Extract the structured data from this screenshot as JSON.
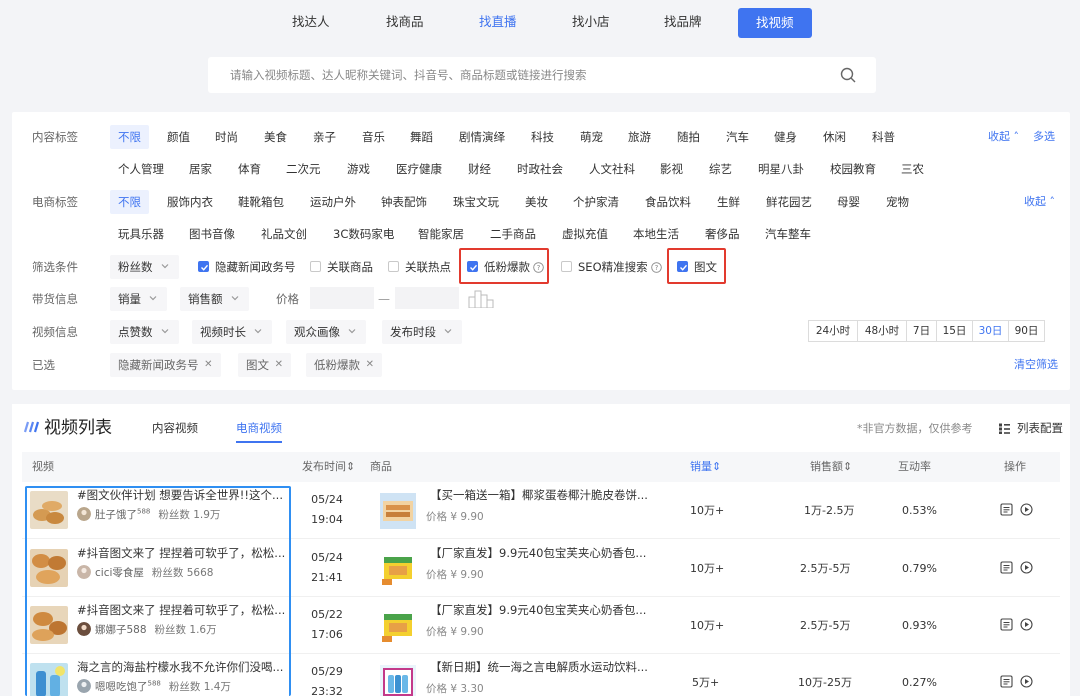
{
  "nav": {
    "items": [
      "找达人",
      "找商品",
      "找直播",
      "找小店",
      "找品牌",
      "找视频"
    ],
    "active_index": 2,
    "current_index": 5
  },
  "search": {
    "placeholder": "请输入视频标题、达人昵称关键词、抖音号、商品标题或链接进行搜索"
  },
  "filters": {
    "content": {
      "label": "内容标签",
      "row1": [
        "不限",
        "颜值",
        "时尚",
        "美食",
        "亲子",
        "音乐",
        "舞蹈",
        "剧情演绎",
        "科技",
        "萌宠",
        "旅游",
        "随拍",
        "汽车",
        "健身",
        "休闲",
        "科普"
      ],
      "row2": [
        "个人管理",
        "居家",
        "体育",
        "二次元",
        "游戏",
        "医疗健康",
        "财经",
        "时政社会",
        "人文社科",
        "影视",
        "综艺",
        "明星八卦",
        "校园教育",
        "三农"
      ],
      "collapse": "收起",
      "multi": "多选"
    },
    "ecom": {
      "label": "电商标签",
      "row1": [
        "不限",
        "服饰内衣",
        "鞋靴箱包",
        "运动户外",
        "钟表配饰",
        "珠宝文玩",
        "美妆",
        "个护家清",
        "食品饮料",
        "生鲜",
        "鲜花园艺",
        "母婴",
        "宠物"
      ],
      "row2": [
        "玩具乐器",
        "图书音像",
        "礼品文创",
        "3C数码家电",
        "智能家居",
        "二手商品",
        "虚拟充值",
        "本地生活",
        "奢侈品",
        "汽车整车"
      ],
      "collapse": "收起"
    },
    "conditions": {
      "label": "筛选条件",
      "dropdown": "粉丝数",
      "checks": [
        {
          "label": "隐藏新闻政务号",
          "checked": true
        },
        {
          "label": "关联商品",
          "checked": false
        },
        {
          "label": "关联热点",
          "checked": false
        },
        {
          "label": "低粉爆款",
          "checked": true
        },
        {
          "label": "SEO精准搜索",
          "checked": false
        },
        {
          "label": "图文",
          "checked": true
        }
      ]
    },
    "goods": {
      "label": "带货信息",
      "d1": "销量",
      "d2": "销售额",
      "price": "价格",
      "dash": "—"
    },
    "video": {
      "label": "视频信息",
      "d1": "点赞数",
      "d2": "视频时长",
      "d3": "观众画像",
      "d4": "发布时段",
      "times": [
        "24小时",
        "48小时",
        "7日",
        "15日",
        "30日",
        "90日"
      ],
      "time_active": 4
    },
    "selected": {
      "label": "已选",
      "chips": [
        "隐藏新闻政务号",
        "图文",
        "低粉爆款"
      ],
      "clear": "清空筛选"
    }
  },
  "list": {
    "title": "视频列表",
    "tabs": [
      "内容视频",
      "电商视频"
    ],
    "active_tab": 1,
    "note": "*非官方数据，仅供参考",
    "config": "列表配置",
    "columns": [
      "视频",
      "发布时间",
      "商品",
      "销量",
      "销售额",
      "互动率",
      "操作"
    ],
    "rows": [
      {
        "title": "#图文伙伴计划 想要告诉全世界!!这个...",
        "author": "肚子饿了",
        "author_sup": "588",
        "fans": "粉丝数 1.9万",
        "date": "05/24",
        "time": "19:04",
        "product": "【买一箱送一箱】椰浆蛋卷椰汁脆皮卷饼...",
        "price": "价格 ¥ 9.90",
        "sales": "10万+",
        "revenue": "1万-2.5万",
        "rate": "0.53%"
      },
      {
        "title": "#抖音图文来了 捏捏着可软乎了，松松...",
        "author": "cici零食屋",
        "author_sup": "",
        "fans": "粉丝数 5668",
        "date": "05/24",
        "time": "21:41",
        "product": "【厂家直发】9.9元40包宝芙夹心奶香包...",
        "price": "价格 ¥ 9.90",
        "sales": "10万+",
        "revenue": "2.5万-5万",
        "rate": "0.79%"
      },
      {
        "title": "#抖音图文来了 捏捏着可软乎了，松松...",
        "author": "娜娜子588",
        "author_sup": "",
        "fans": "粉丝数 1.6万",
        "date": "05/22",
        "time": "17:06",
        "product": "【厂家直发】9.9元40包宝芙夹心奶香包...",
        "price": "价格 ¥ 9.90",
        "sales": "10万+",
        "revenue": "2.5万-5万",
        "rate": "0.93%"
      },
      {
        "title": "海之言的海盐柠檬水我不允许你们没喝...",
        "author": "嗯嗯吃饱了",
        "author_sup": "588",
        "fans": "粉丝数 1.4万",
        "date": "05/29",
        "time": "23:32",
        "product": "【新日期】统一海之言电解质水运动饮料...",
        "price": "价格 ¥ 3.30",
        "sales": "5万+",
        "revenue": "10万-25万",
        "rate": "0.27%"
      }
    ]
  }
}
